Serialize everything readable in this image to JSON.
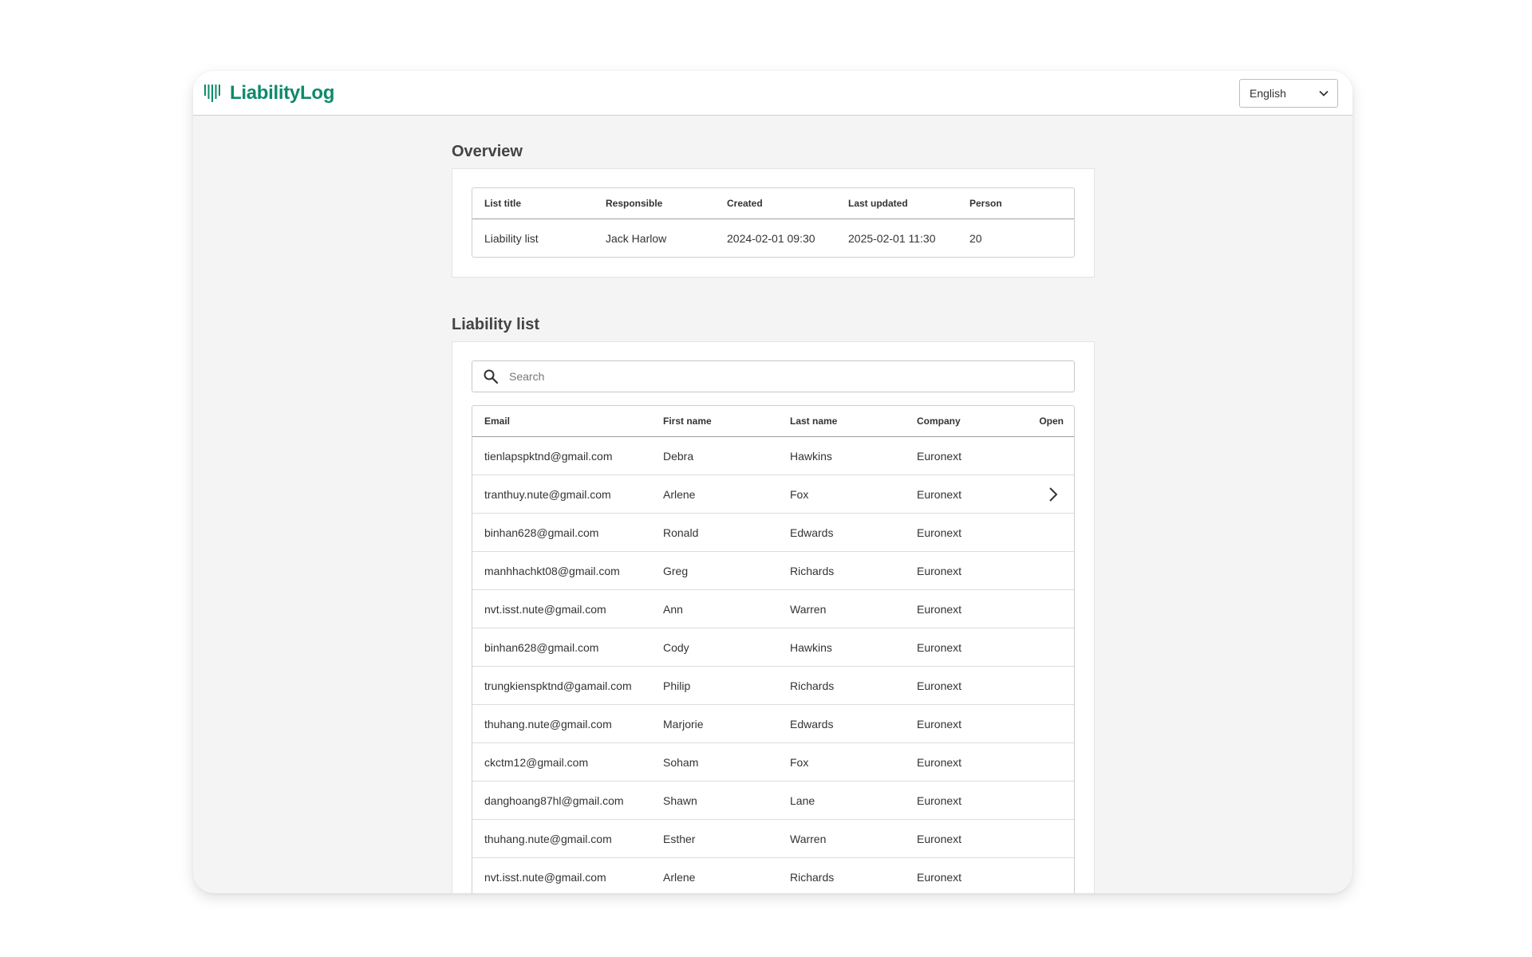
{
  "app": {
    "name": "LiabilityLog",
    "brand_color": "#0d8a6a"
  },
  "header": {
    "language": "English",
    "language_icon": "chevron-down-icon"
  },
  "overview": {
    "title": "Overview",
    "columns": [
      "List title",
      "Responsible",
      "Created",
      "Last updated",
      "Person"
    ],
    "row": {
      "list_title": "Liability list",
      "responsible": "Jack Harlow",
      "created": "2024-02-01 09:30",
      "last_updated": "2025-02-01 11:30",
      "person": "20"
    }
  },
  "liability_list": {
    "title": "Liability list",
    "search_placeholder": "Search",
    "search_icon": "search-icon",
    "columns": [
      "Email",
      "First name",
      "Last name",
      "Company",
      "Open"
    ],
    "rows": [
      {
        "email": "tienlapspktnd@gmail.com",
        "first": "Debra",
        "last": "Hawkins",
        "company": "Euronext",
        "open": false
      },
      {
        "email": "tranthuy.nute@gmail.com",
        "first": "Arlene",
        "last": "Fox",
        "company": "Euronext",
        "open": true
      },
      {
        "email": "binhan628@gmail.com",
        "first": "Ronald",
        "last": "Edwards",
        "company": "Euronext",
        "open": false
      },
      {
        "email": "manhhachkt08@gmail.com",
        "first": "Greg",
        "last": "Richards",
        "company": "Euronext",
        "open": false
      },
      {
        "email": "nvt.isst.nute@gmail.com",
        "first": "Ann",
        "last": "Warren",
        "company": "Euronext",
        "open": false
      },
      {
        "email": "binhan628@gmail.com",
        "first": "Cody",
        "last": "Hawkins",
        "company": "Euronext",
        "open": false
      },
      {
        "email": "trungkienspktnd@gamail.com",
        "first": "Philip",
        "last": "Richards",
        "company": "Euronext",
        "open": false
      },
      {
        "email": "thuhang.nute@gmail.com",
        "first": "Marjorie",
        "last": "Edwards",
        "company": "Euronext",
        "open": false
      },
      {
        "email": "ckctm12@gmail.com",
        "first": "Soham",
        "last": "Fox",
        "company": "Euronext",
        "open": false
      },
      {
        "email": "danghoang87hl@gmail.com",
        "first": "Shawn",
        "last": "Lane",
        "company": "Euronext",
        "open": false
      },
      {
        "email": "thuhang.nute@gmail.com",
        "first": "Esther",
        "last": "Warren",
        "company": "Euronext",
        "open": false
      },
      {
        "email": "nvt.isst.nute@gmail.com",
        "first": "Arlene",
        "last": "Richards",
        "company": "Euronext",
        "open": false
      }
    ]
  }
}
